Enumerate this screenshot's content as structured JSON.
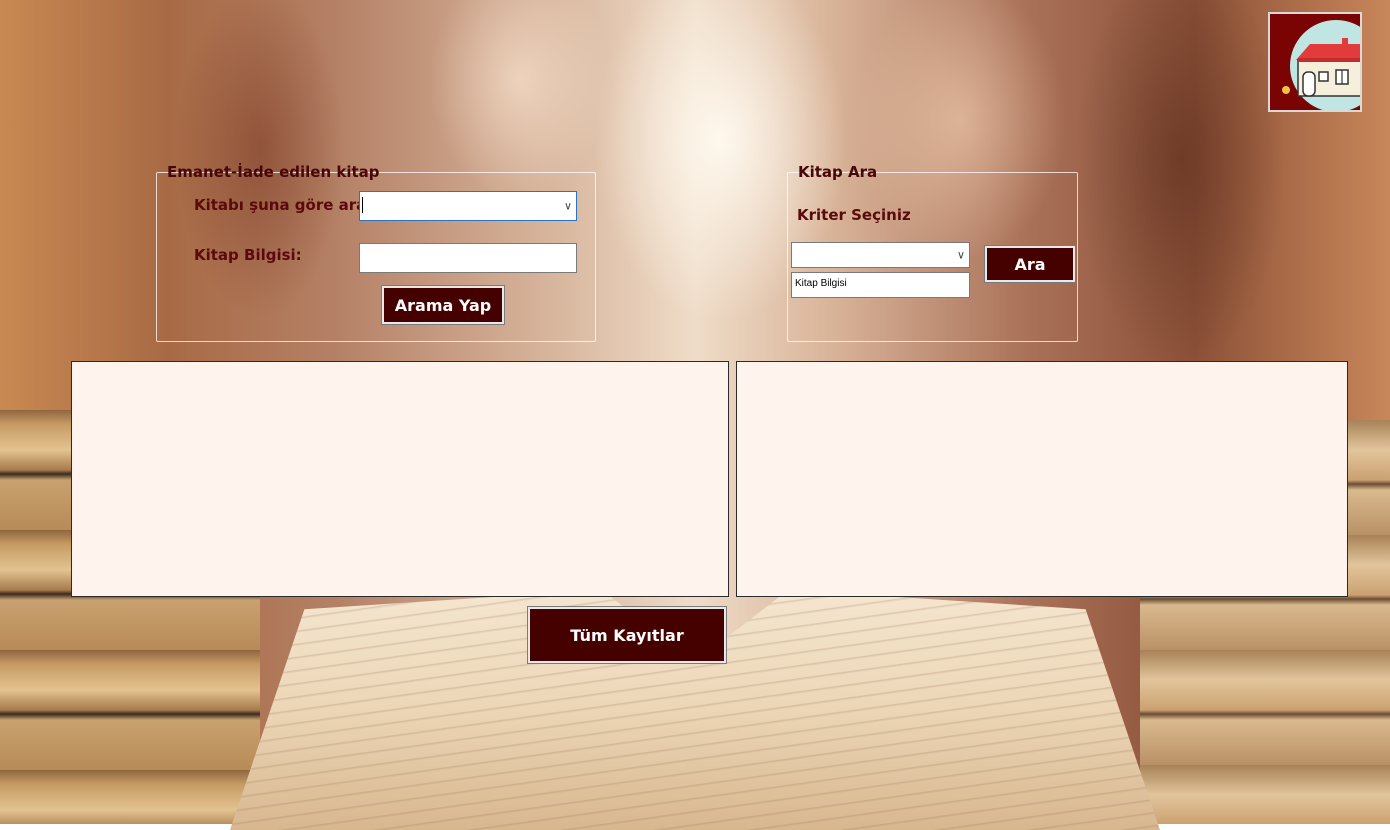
{
  "left_panel": {
    "legend": "Emanet-İade edilen kitap",
    "search_by_label": "Kitabı şuna göre ara:",
    "search_by_value": "",
    "book_info_label": "Kitap Bilgisi:",
    "book_info_value": "",
    "search_button": "Arama Yap"
  },
  "right_panel": {
    "legend": "Kitap Ara",
    "criteria_label": "Kriter Seçiniz",
    "criteria_value": "",
    "search_button": "Ara",
    "text_value": "Kitap Bilgisi"
  },
  "grids": {
    "left_rows": [],
    "right_rows": []
  },
  "all_records_button": "Tüm Kayıtlar",
  "icons": {
    "home": "home-icon",
    "dropdown": "chevron-down-icon"
  },
  "colors": {
    "button_bg": "#450000",
    "label": "#5a0a0a",
    "grid_bg": "#fff3ee"
  }
}
